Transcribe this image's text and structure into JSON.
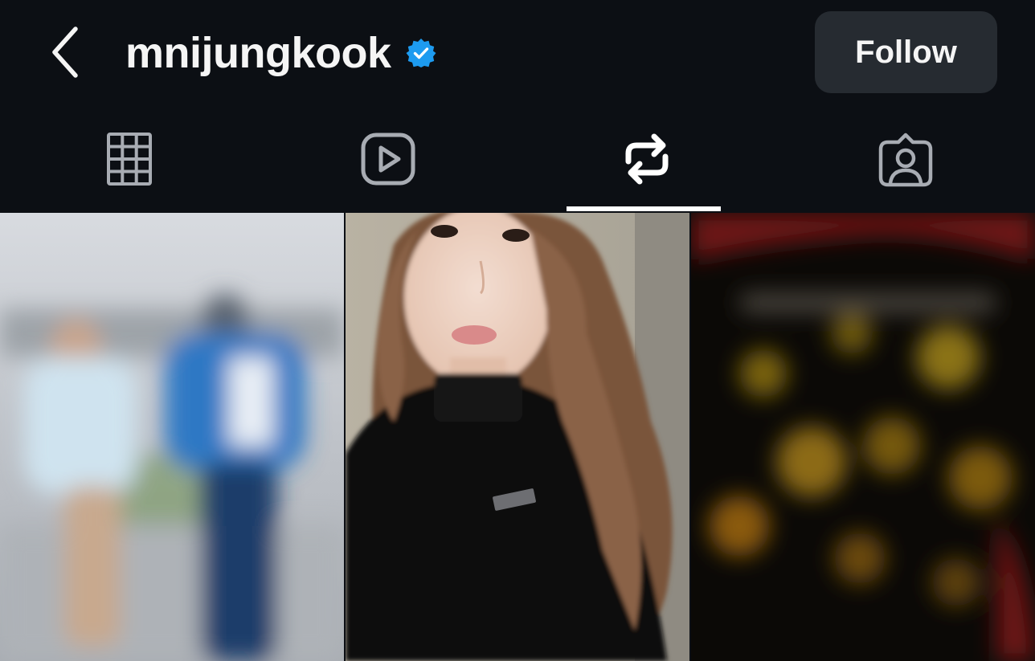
{
  "header": {
    "username": "mnijungkook",
    "verified": true,
    "follow_label": "Follow",
    "back_icon": "chevron-left-icon",
    "verified_icon": "verified-badge-icon"
  },
  "tabs": [
    {
      "name": "posts",
      "icon": "grid-icon",
      "active": false
    },
    {
      "name": "reels",
      "icon": "reels-play-icon",
      "active": false
    },
    {
      "name": "reposts",
      "icon": "repost-icon",
      "active": true
    },
    {
      "name": "tagged",
      "icon": "tagged-person-icon",
      "active": false
    }
  ],
  "colors": {
    "background": "#0c0f14",
    "follow_button": "#262b31",
    "verified_blue": "#1d9bf0",
    "active_tab": "#ffffff",
    "inactive_tab": "#a8acb3"
  },
  "grid": {
    "tiles": [
      {
        "description_icon": "blurred-video-thumbnail",
        "blurred": true
      },
      {
        "description_icon": "video-thumbnail",
        "blurred": false
      },
      {
        "description_icon": "blurred-video-thumbnail",
        "blurred": true
      }
    ]
  }
}
